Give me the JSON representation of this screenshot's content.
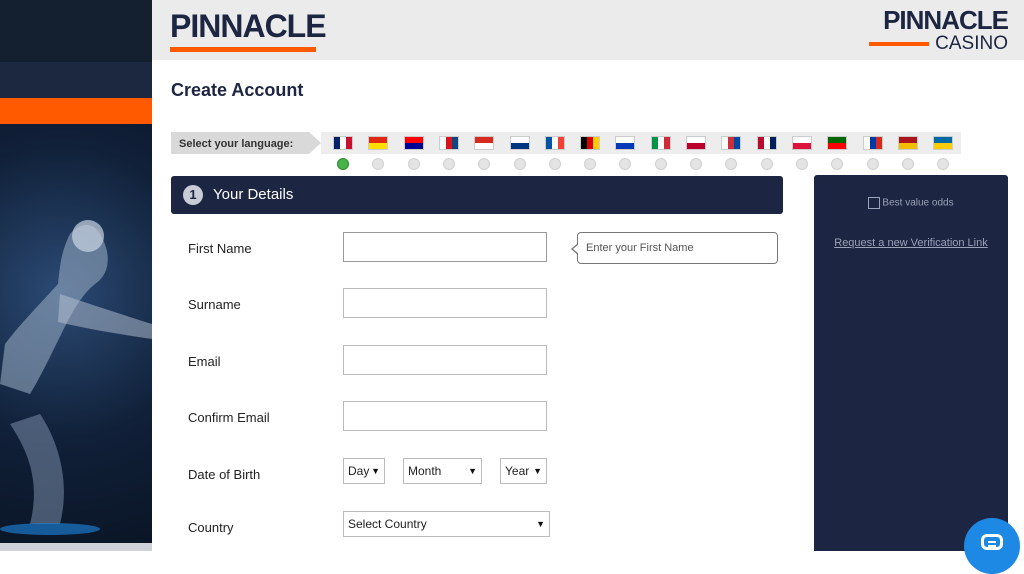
{
  "header": {
    "logo_main": "PINNACLE",
    "logo_casino_name": "PINNACLE",
    "logo_casino_sub": "CASINO"
  },
  "title": "Create Account",
  "language": {
    "label": "Select your language:",
    "selected_index": 0,
    "flags": [
      {
        "icon": "uk-flag-icon",
        "colors": [
          "#012169",
          "#ffffff",
          "#c8102e"
        ]
      },
      {
        "icon": "china-flag-icon",
        "colors": [
          "#de2910",
          "#ffde00"
        ]
      },
      {
        "icon": "taiwan-flag-icon",
        "colors": [
          "#fe0000",
          "#000095"
        ]
      },
      {
        "icon": "czech-flag-icon",
        "colors": [
          "#ffffff",
          "#d7141a",
          "#11457e"
        ]
      },
      {
        "icon": "canada-flag-icon",
        "colors": [
          "#d52b1e",
          "#ffffff"
        ]
      },
      {
        "icon": "finland-flag-icon",
        "colors": [
          "#ffffff",
          "#003580"
        ]
      },
      {
        "icon": "france-flag-icon",
        "colors": [
          "#0055a4",
          "#ffffff",
          "#ef4135"
        ]
      },
      {
        "icon": "germany-flag-icon",
        "colors": [
          "#000000",
          "#dd0000",
          "#ffce00"
        ]
      },
      {
        "icon": "israel-flag-icon",
        "colors": [
          "#ffffff",
          "#0038b8"
        ]
      },
      {
        "icon": "italy-flag-icon",
        "colors": [
          "#009246",
          "#ffffff",
          "#ce2b37"
        ]
      },
      {
        "icon": "japan-flag-icon",
        "colors": [
          "#ffffff",
          "#bc002d"
        ]
      },
      {
        "icon": "korea-flag-icon",
        "colors": [
          "#ffffff",
          "#cd2e3a",
          "#0047a0"
        ]
      },
      {
        "icon": "norway-flag-icon",
        "colors": [
          "#ba0c2f",
          "#ffffff",
          "#00205b"
        ]
      },
      {
        "icon": "poland-flag-icon",
        "colors": [
          "#ffffff",
          "#dc143c"
        ]
      },
      {
        "icon": "portugal-flag-icon",
        "colors": [
          "#006600",
          "#ff0000"
        ]
      },
      {
        "icon": "russia-flag-icon",
        "colors": [
          "#ffffff",
          "#0039a6",
          "#d52b1e"
        ]
      },
      {
        "icon": "spain-flag-icon",
        "colors": [
          "#aa151b",
          "#f1bf00"
        ]
      },
      {
        "icon": "sweden-flag-icon",
        "colors": [
          "#006aa7",
          "#fecc00"
        ]
      }
    ]
  },
  "details": {
    "step_number": "1",
    "heading": "Your Details",
    "first_name_label": "First Name",
    "first_name_value": "",
    "surname_label": "Surname",
    "surname_value": "",
    "email_label": "Email",
    "email_value": "",
    "confirm_email_label": "Confirm Email",
    "confirm_email_value": "",
    "dob_label": "Date of Birth",
    "dob_day": "Day",
    "dob_month": "Month",
    "dob_year": "Year",
    "country_label": "Country",
    "country_value": "Select Country"
  },
  "tooltip": {
    "text": "Enter your First Name"
  },
  "side_panel": {
    "image_alt": "Best value odds",
    "verify_link": "Request a new Verification Link"
  },
  "colors": {
    "navy": "#1c2541",
    "orange": "#ff5a00",
    "selected_radio": "#47b34a",
    "chat": "#1e88e5"
  }
}
